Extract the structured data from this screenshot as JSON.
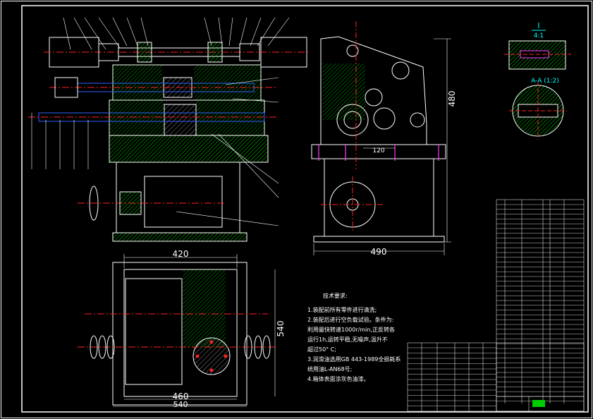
{
  "dimensions": {
    "side_height": "480",
    "side_base_width": "490",
    "side_offset": "120",
    "plan_top_width": "420",
    "plan_height": "540",
    "plan_bottom_inner": "460",
    "plan_bottom_outer": "540"
  },
  "detail": {
    "section_roman": "I",
    "section_scale": "4:1",
    "aa_label": "A-A (1:2)"
  },
  "technical_requirements": {
    "title": "技术要求:",
    "lines": [
      "1.装配前所有零件进行清洗;",
      "2.装配后进行空负载试验。条件为:",
      "利用最快转速1000r/min,正反转各",
      "运行1h,运转平稳,无噪声,温升不",
      "超过50° C;",
      "3.润滑油选用GB 443-1989全损耗系",
      "统用油L-AN68号;",
      "4.箱体表面涂灰色油漆。"
    ]
  },
  "colors": {
    "background": "#000000",
    "outline": "#ffffff",
    "hatch": "#00cc00",
    "centerline": "#ff2020",
    "accent_blue": "#3060ff",
    "accent_magenta": "#ff40ff"
  }
}
